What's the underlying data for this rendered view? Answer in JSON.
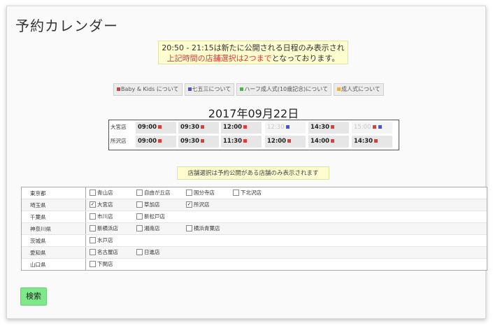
{
  "page": {
    "title": "予約カレンダー"
  },
  "notice": {
    "line1": "20:50 - 21:15は新たに公開される日程のみ表示され",
    "line2_red": "上記時間の店舗選択は2つまで",
    "line2_rest": "となっております。"
  },
  "tags": [
    {
      "label": "Baby & Kids について",
      "color": "#e53935"
    },
    {
      "label": "七五三について",
      "color": "#3f51ff"
    },
    {
      "label": "ハーフ成人式(10歳記念)について",
      "color": "#3bbd3b"
    },
    {
      "label": "成人式について",
      "color": "#f0b040"
    }
  ],
  "date": "2017年09月22日",
  "stores": [
    {
      "name": "大宮店",
      "slots": [
        {
          "time": "09:00",
          "marks": [
            "#e53935"
          ],
          "disabled": false
        },
        {
          "time": "09:30",
          "marks": [
            "#e53935"
          ],
          "disabled": false
        },
        {
          "time": "12:00",
          "marks": [
            "#e53935"
          ],
          "disabled": false
        },
        {
          "time": "12:30",
          "marks": [
            "#3f51ff"
          ],
          "disabled": true
        },
        {
          "time": "14:30",
          "marks": [
            "#e53935"
          ],
          "disabled": false
        },
        {
          "time": "15:00",
          "marks": [
            "#e53935",
            "#3f51ff"
          ],
          "disabled": true
        }
      ]
    },
    {
      "name": "所沢店",
      "slots": [
        {
          "time": "09:00",
          "marks": [
            "#e53935"
          ],
          "disabled": false
        },
        {
          "time": "09:30",
          "marks": [
            "#e53935"
          ],
          "disabled": false
        },
        {
          "time": "11:30",
          "marks": [
            "#e53935"
          ],
          "disabled": false
        },
        {
          "time": "12:00",
          "marks": [
            "#e53935"
          ],
          "disabled": false
        },
        {
          "time": "14:00",
          "marks": [
            "#e53935"
          ],
          "disabled": false
        },
        {
          "time": "14:30",
          "marks": [
            "#e53935"
          ],
          "disabled": false
        }
      ]
    }
  ],
  "store_info": "店舗選択は予約公開がある店舗のみ表示されます",
  "prefectures": [
    {
      "name": "東京都",
      "shops": [
        {
          "name": "青山店",
          "checked": false
        },
        {
          "name": "自由が丘店",
          "checked": false
        },
        {
          "name": "国分寺店",
          "checked": false
        },
        {
          "name": "下北沢店",
          "checked": false
        }
      ]
    },
    {
      "name": "埼玉県",
      "shops": [
        {
          "name": "大宮店",
          "checked": true
        },
        {
          "name": "草加店",
          "checked": false
        },
        {
          "name": "所沢店",
          "checked": true
        }
      ]
    },
    {
      "name": "千葉県",
      "shops": [
        {
          "name": "市川店",
          "checked": false
        },
        {
          "name": "新松戸店",
          "checked": false
        }
      ]
    },
    {
      "name": "神奈川県",
      "shops": [
        {
          "name": "新横浜店",
          "checked": false
        },
        {
          "name": "湘南店",
          "checked": false
        },
        {
          "name": "横浜青葉店",
          "checked": false
        }
      ]
    },
    {
      "name": "茨城県",
      "shops": [
        {
          "name": "水戸店",
          "checked": false
        }
      ]
    },
    {
      "name": "愛知県",
      "shops": [
        {
          "name": "名古屋店",
          "checked": false
        },
        {
          "name": "日進店",
          "checked": false
        }
      ]
    },
    {
      "name": "山口県",
      "shops": [
        {
          "name": "下関店",
          "checked": false
        }
      ]
    }
  ],
  "search_label": "検索"
}
